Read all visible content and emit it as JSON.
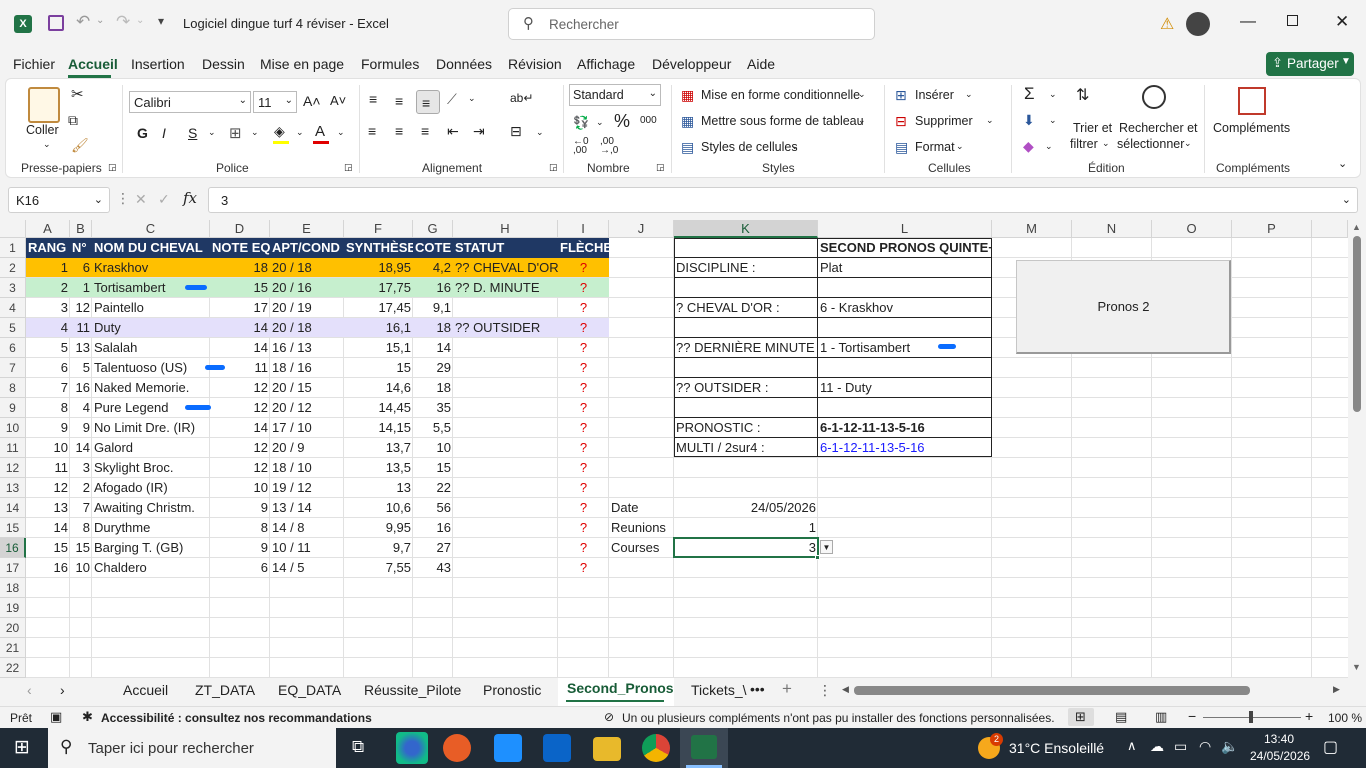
{
  "titlebar": {
    "doc_title": "Logiciel dingue turf 4 réviser  -  Excel",
    "search_placeholder": "Rechercher"
  },
  "menu": {
    "items": [
      "Fichier",
      "Accueil",
      "Insertion",
      "Dessin",
      "Mise en page",
      "Formules",
      "Données",
      "Révision",
      "Affichage",
      "Développeur",
      "Aide"
    ],
    "share": "Partager"
  },
  "ribbon": {
    "coller": "Coller",
    "font_name": "Calibri",
    "font_size": "11",
    "number_format": "Standard",
    "mfc": "Mise en forme conditionnelle",
    "mstab": "Mettre sous forme de tableau",
    "styles": "Styles de cellules",
    "inserer": "Insérer",
    "supprimer": "Supprimer",
    "format": "Format",
    "trier1": "Trier et",
    "trier2": "filtrer",
    "rech1": "Rechercher et",
    "rech2": "sélectionner",
    "complements": "Compléments",
    "groups": {
      "presse": "Presse-papiers",
      "police": "Police",
      "alignement": "Alignement",
      "nombre": "Nombre",
      "styles": "Styles",
      "cellules": "Cellules",
      "edition": "Édition",
      "complements": "Compléments"
    }
  },
  "formula": {
    "namebox": "K16",
    "value": "3"
  },
  "columns": [
    "A",
    "B",
    "C",
    "D",
    "E",
    "F",
    "G",
    "H",
    "I",
    "J",
    "K",
    "L",
    "M",
    "N",
    "O",
    "P"
  ],
  "header_row": [
    "RANG",
    "N°",
    "NOM DU CHEVAL",
    "NOTE EQ",
    "APT/COND",
    "SYNTHÈSE",
    "COTE",
    "STATUT",
    "FLÈCHE"
  ],
  "rows": [
    [
      "1",
      "6",
      "Kraskhov",
      "18",
      "20 / 18",
      "18,95",
      "4,2",
      "?? CHEVAL D'OR",
      "?"
    ],
    [
      "2",
      "1",
      "Tortisambert",
      "15",
      "20 / 16",
      "17,75",
      "16",
      "?? D. MINUTE",
      "?"
    ],
    [
      "3",
      "12",
      "Paintello",
      "17",
      "20 / 19",
      "17,45",
      "9,1",
      "",
      "?"
    ],
    [
      "4",
      "11",
      "Duty",
      "14",
      "20 / 18",
      "16,1",
      "18",
      "?? OUTSIDER",
      "?"
    ],
    [
      "5",
      "13",
      "Salalah",
      "14",
      "16 / 13",
      "15,1",
      "14",
      "",
      "?"
    ],
    [
      "6",
      "5",
      "Talentuoso (US)",
      "11",
      "18 / 16",
      "15",
      "29",
      "",
      "?"
    ],
    [
      "7",
      "16",
      "Naked Memorie.",
      "12",
      "20 / 15",
      "14,6",
      "18",
      "",
      "?"
    ],
    [
      "8",
      "4",
      "Pure Legend",
      "12",
      "20 / 12",
      "14,45",
      "35",
      "",
      "?"
    ],
    [
      "9",
      "9",
      "No Limit Dre. (IR)",
      "14",
      "17 / 10",
      "14,15",
      "5,5",
      "",
      "?"
    ],
    [
      "10",
      "14",
      "Galord",
      "12",
      "20 / 9",
      "13,7",
      "10",
      "",
      "?"
    ],
    [
      "11",
      "3",
      "Skylight Broc.",
      "12",
      "18 / 10",
      "13,5",
      "15",
      "",
      "?"
    ],
    [
      "12",
      "2",
      "Afogado (IR)",
      "10",
      "19 / 12",
      "13",
      "22",
      "",
      "?"
    ],
    [
      "13",
      "7",
      "Awaiting Christm.",
      "9",
      "13 / 14",
      "10,6",
      "56",
      "",
      "?"
    ],
    [
      "14",
      "8",
      "Durythme",
      "8",
      "14 / 8",
      "9,95",
      "16",
      "",
      "?"
    ],
    [
      "15",
      "15",
      "Barging T. (GB)",
      "9",
      "10 / 11",
      "9,7",
      "27",
      "",
      "?"
    ],
    [
      "16",
      "10",
      "Chaldero",
      "6",
      "14 / 5",
      "7,55",
      "43",
      "",
      "?"
    ]
  ],
  "second_pronos": {
    "title": "SECOND PRONOS QUINTE+",
    "discipline_label": "DISCIPLINE :",
    "discipline_value": "Plat",
    "or_label": "? CHEVAL D'OR :",
    "or_value": "6 - Kraskhov",
    "dm_label": "?? DERNIÈRE MINUTE :",
    "dm_value": "1 - Tortisambert",
    "out_label": "?? OUTSIDER :",
    "out_value": "11 - Duty",
    "prono_label": "PRONOSTIC :",
    "prono_value": "6-1-12-11-13-5-16",
    "multi_label": "MULTI / 2sur4 :",
    "multi_value": "6-1-12-11-13-5-16"
  },
  "params": {
    "date_label": "Date",
    "date_value": "24/05/2026",
    "reunions_label": "Reunions",
    "reunions_value": "1",
    "courses_label": "Courses",
    "courses_value": "3"
  },
  "button_pronos": "Pronos 2",
  "sheets": [
    "Accueil",
    "ZT_DATA",
    "EQ_DATA",
    "Réussite_Pilote",
    "Pronostic",
    "Second_Pronos",
    "Tickets_\\"
  ],
  "status": {
    "ready": "Prêt",
    "accessibility": "Accessibilité : consultez nos recommandations",
    "message": "Un ou plusieurs compléments n'ont pas pu installer des fonctions personnalisées.",
    "zoom": "100 %"
  },
  "taskbar": {
    "search": "Taper ici pour rechercher",
    "weather": "31°C  Ensoleillé",
    "time": "13:40",
    "date": "24/05/2026",
    "badge": "2"
  },
  "colors": {
    "excel_green": "#217346",
    "gold_row": "#ffc000",
    "green_row": "#c6efce",
    "lavender_row": "#e4e0fb",
    "header_navy": "#1f3864",
    "red_q": "#e00000"
  }
}
